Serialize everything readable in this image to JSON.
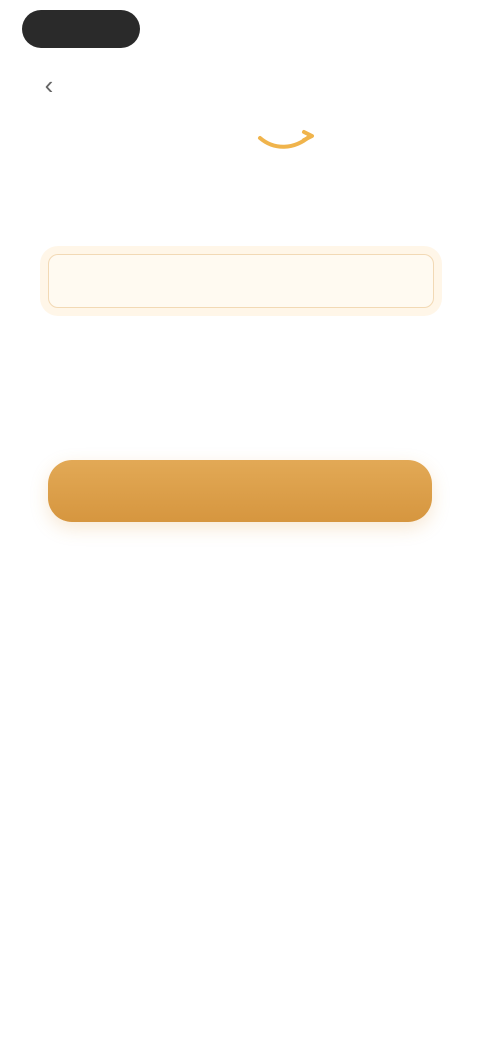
{
  "status_bar": {
    "time": "",
    "right_text": ""
  },
  "topbar": {
    "back_glyph": "‹",
    "right_link": ""
  },
  "logo": {
    "text": "",
    "icon": "amazon-smile-icon"
  },
  "content": {
    "headline": "",
    "body_text": "",
    "body_link": "",
    "section_title": "",
    "input_value": ""
  },
  "actions": {
    "primary_button": "",
    "legal_text": "",
    "help_link": "",
    "footer_text": ""
  },
  "colors": {
    "accent": "#d6963f",
    "link": "#5a8fb0",
    "background": "#ffffff"
  }
}
